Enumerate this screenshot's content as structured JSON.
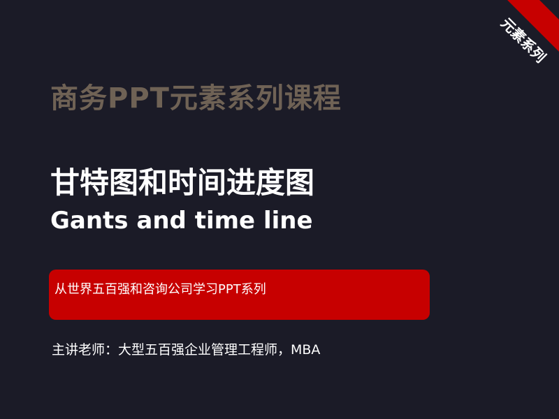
{
  "slide": {
    "course_title": "商务PPT元素系列课程",
    "main_title": "甘特图和时间进度图",
    "subtitle_en": "Gants and time line",
    "banner_text": "从世界五百强和咨询公司学习PPT系列",
    "lecturer": "主讲老师：大型五百强企业管理工程师，MBA",
    "corner_badge": "元素系列"
  },
  "colors": {
    "background": "#1b1b27",
    "course_title": "#6f6255",
    "accent_red": "#c70000",
    "text_white": "#ffffff"
  }
}
